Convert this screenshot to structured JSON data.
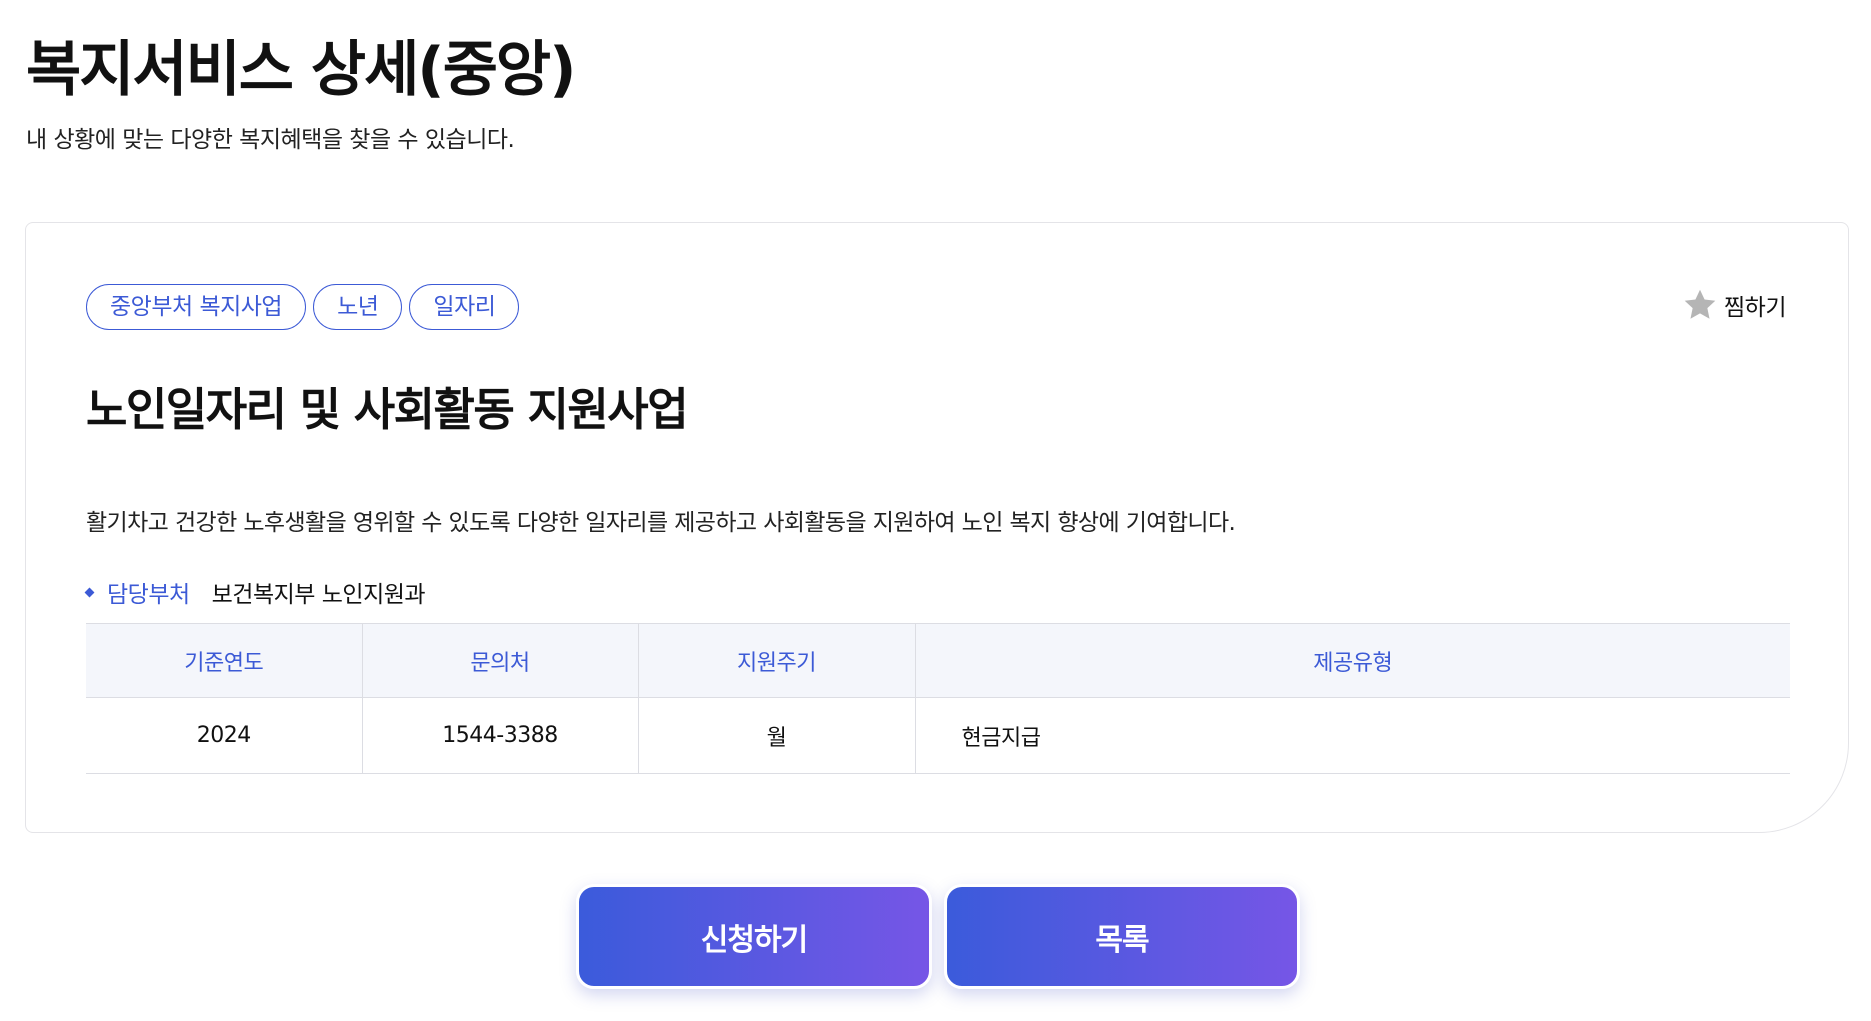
{
  "header": {
    "title": "복지서비스 상세(중앙)",
    "subtitle": "내 상황에 맞는 다양한 복지혜택을 찾을 수 있습니다."
  },
  "card": {
    "tags": [
      "중앙부처 복지사업",
      "노년",
      "일자리"
    ],
    "bookmark": {
      "label": "찜하기",
      "icon": "star-icon",
      "color": "#b5b5b5"
    },
    "title": "노인일자리 및 사회활동 지원사업",
    "description": "활기차고 건강한 노후생활을 영위할 수 있도록 다양한 일자리를 제공하고 사회활동을 지원하여 노인 복지 향상에 기여합니다.",
    "department": {
      "label": "담당부처",
      "value": "보건복지부 노인지원과"
    },
    "table": {
      "headers": [
        "기준연도",
        "문의처",
        "지원주기",
        "제공유형"
      ],
      "row": [
        "2024",
        "1544-3388",
        "월",
        "현금지급"
      ]
    }
  },
  "actions": {
    "apply_label": "신청하기",
    "list_label": "목록"
  },
  "colors": {
    "accent": "#3c5ad6",
    "button_gradient_start": "#3b5bdb",
    "button_gradient_end": "#7656e6",
    "table_header_bg": "#f4f6fb"
  }
}
